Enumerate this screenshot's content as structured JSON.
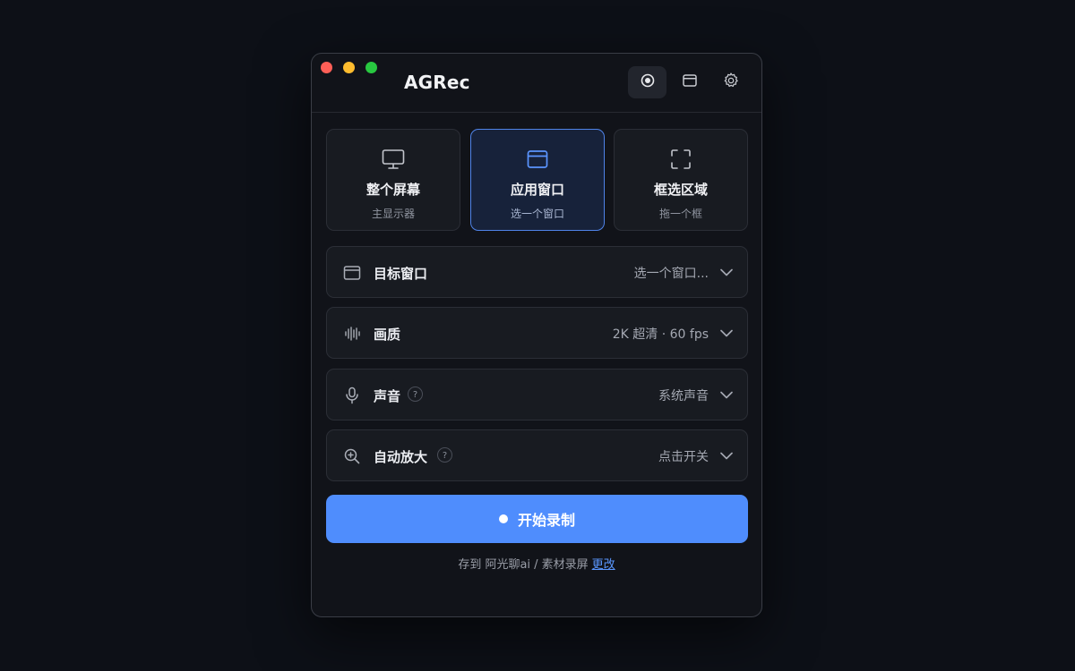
{
  "window": {
    "title": "AGRec"
  },
  "toolbar": {
    "record_icon": "record-icon",
    "window_icon": "window-icon",
    "settings_icon": "gear-icon"
  },
  "modes": [
    {
      "label": "整个屏幕",
      "sub": "主显示器",
      "icon": "monitor-icon"
    },
    {
      "label": "应用窗口",
      "sub": "选一个窗口",
      "icon": "window-icon",
      "selected": true
    },
    {
      "label": "框选区域",
      "sub": "拖一个框",
      "icon": "crop-frame-icon"
    }
  ],
  "settings": [
    {
      "label": "目标窗口",
      "value": "选一个窗口...",
      "icon": "window-icon"
    },
    {
      "label": "画质",
      "value": "2K 超清 · 60 fps",
      "icon": "waveform-icon"
    },
    {
      "label": "声音",
      "value": "系统声音",
      "icon": "microphone-icon",
      "help": "?"
    },
    {
      "label": "自动放大",
      "value": "点击开关",
      "icon": "zoom-in-icon",
      "help": "?"
    }
  ],
  "start_button": {
    "label": "开始录制"
  },
  "save": {
    "text": "存到 阿光聊ai / 素材录屏",
    "link": "更改"
  },
  "colors": {
    "accent": "#4f8dfd",
    "selected_border": "#4f83e8",
    "background": "#0d1017",
    "panel": "#111319"
  }
}
